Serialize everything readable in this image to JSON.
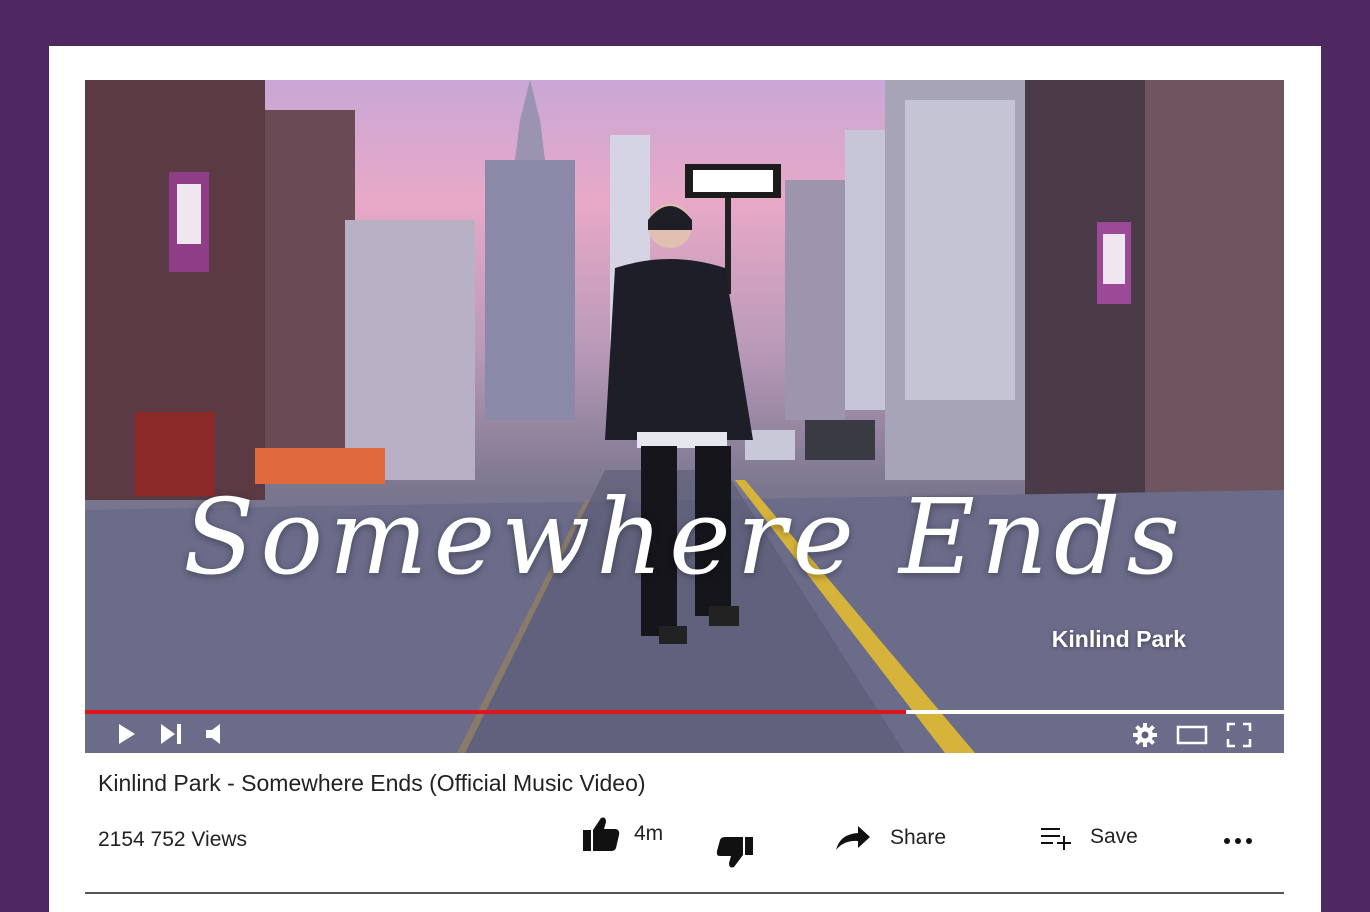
{
  "video": {
    "overlay_title": "Somewhere Ends",
    "overlay_artist": "Kinlind Park",
    "progress": 0.685,
    "colors": {
      "progress_fill": "#e0151c",
      "progress_track": "#ffffff"
    }
  },
  "player_controls": {
    "left": [
      "play-icon",
      "next-icon",
      "volume-icon"
    ],
    "right": [
      "settings-gear-icon",
      "theater-mode-icon",
      "fullscreen-icon"
    ]
  },
  "meta": {
    "title": "Kinlind Park - Somewhere Ends (Official Music Video)",
    "views": "2154 752 Views"
  },
  "actions": {
    "like_count": "4m",
    "share_label": "Share",
    "save_label": "Save",
    "icons": [
      "thumbs-up-icon",
      "thumbs-down-icon",
      "share-arrow-icon",
      "playlist-add-icon",
      "more-dots-icon"
    ]
  },
  "colors": {
    "page_background": "#4f2862",
    "card": "#ffffff"
  }
}
